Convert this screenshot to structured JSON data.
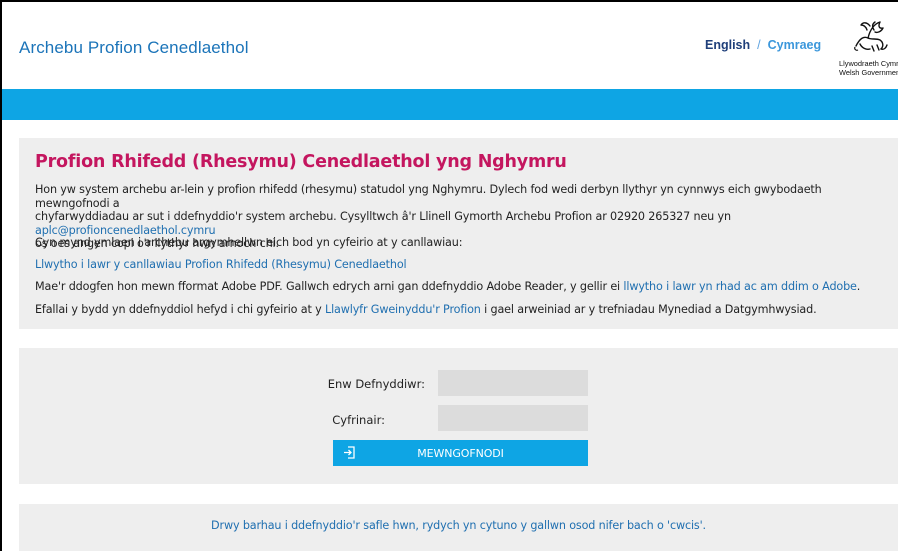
{
  "header": {
    "site_title": "Archebu Profion Cenedlaethol",
    "lang_english": "English",
    "lang_separator": "/",
    "lang_welsh": "Cymraeg",
    "logo_text_cy": "Llywodraeth Cymru",
    "logo_text_en": "Welsh Government"
  },
  "intro": {
    "heading": "Profion Rhifedd (Rhesymu) Cenedlaethol yng Nghymru",
    "para1_line1": "Hon yw system archebu ar-lein y profion rhifedd (rhesymu) statudol yng Nghymru. Dylech fod wedi derbyn llythyr yn cynnwys eich gwybodaeth mewngofnodi a",
    "para1_line2": "chyfarwyddiadau ar sut i ddefnyddio'r system archebu. Cysylltwch â'r Llinell Gymorth Archebu Profion ar 02920 265327 neu yn ",
    "para1_email": "aplc@profioncenedlaethol.cymru",
    "para1_line3": "os oes angen copi o'r llythyr hwn arnoch chi.",
    "para2": "Cyn mynd ymlaen i archebu argymhellwn eich bod yn cyfeirio at y canllawiau:",
    "guidance_link": "Llwytho i lawr y canllawiau Profion Rhifedd (Rhesymu) Cenedlaethol",
    "para3_text": "Mae'r ddogfen hon mewn fformat Adobe PDF. Gallwch edrych arni gan ddefnyddio Adobe Reader, y gellir ei ",
    "para3_link": "llwytho i lawr yn rhad ac am ddim o Adobe",
    "para3_end": ".",
    "para4_text": "Efallai y bydd yn ddefnyddiol hefyd i chi gyfeirio at y ",
    "para4_link": "Llawlyfr Gweinyddu'r Profion",
    "para4_end": " i gael arweiniad ar y trefniadau Mynediad a Datgymhwysiad."
  },
  "login": {
    "username_label": "Enw Defnyddiwr:",
    "username_value": "",
    "password_label": "Cyfrinair:",
    "password_value": "",
    "submit_label": "MEWNGOFNODI",
    "submit_icon": "sign-in-icon"
  },
  "footer": {
    "cookie_text": "Drwy barhau i ddefnyddio'r safle hwn, rydych yn cytuno y gallwn osod nifer bach o 'cwcis'."
  },
  "colors": {
    "brand_blue": "#0ea5e4",
    "title_blue": "#1b74b9",
    "heading_magenta": "#c4165f",
    "link_blue": "#1f6fb0",
    "panel_grey": "#eeeeee"
  }
}
